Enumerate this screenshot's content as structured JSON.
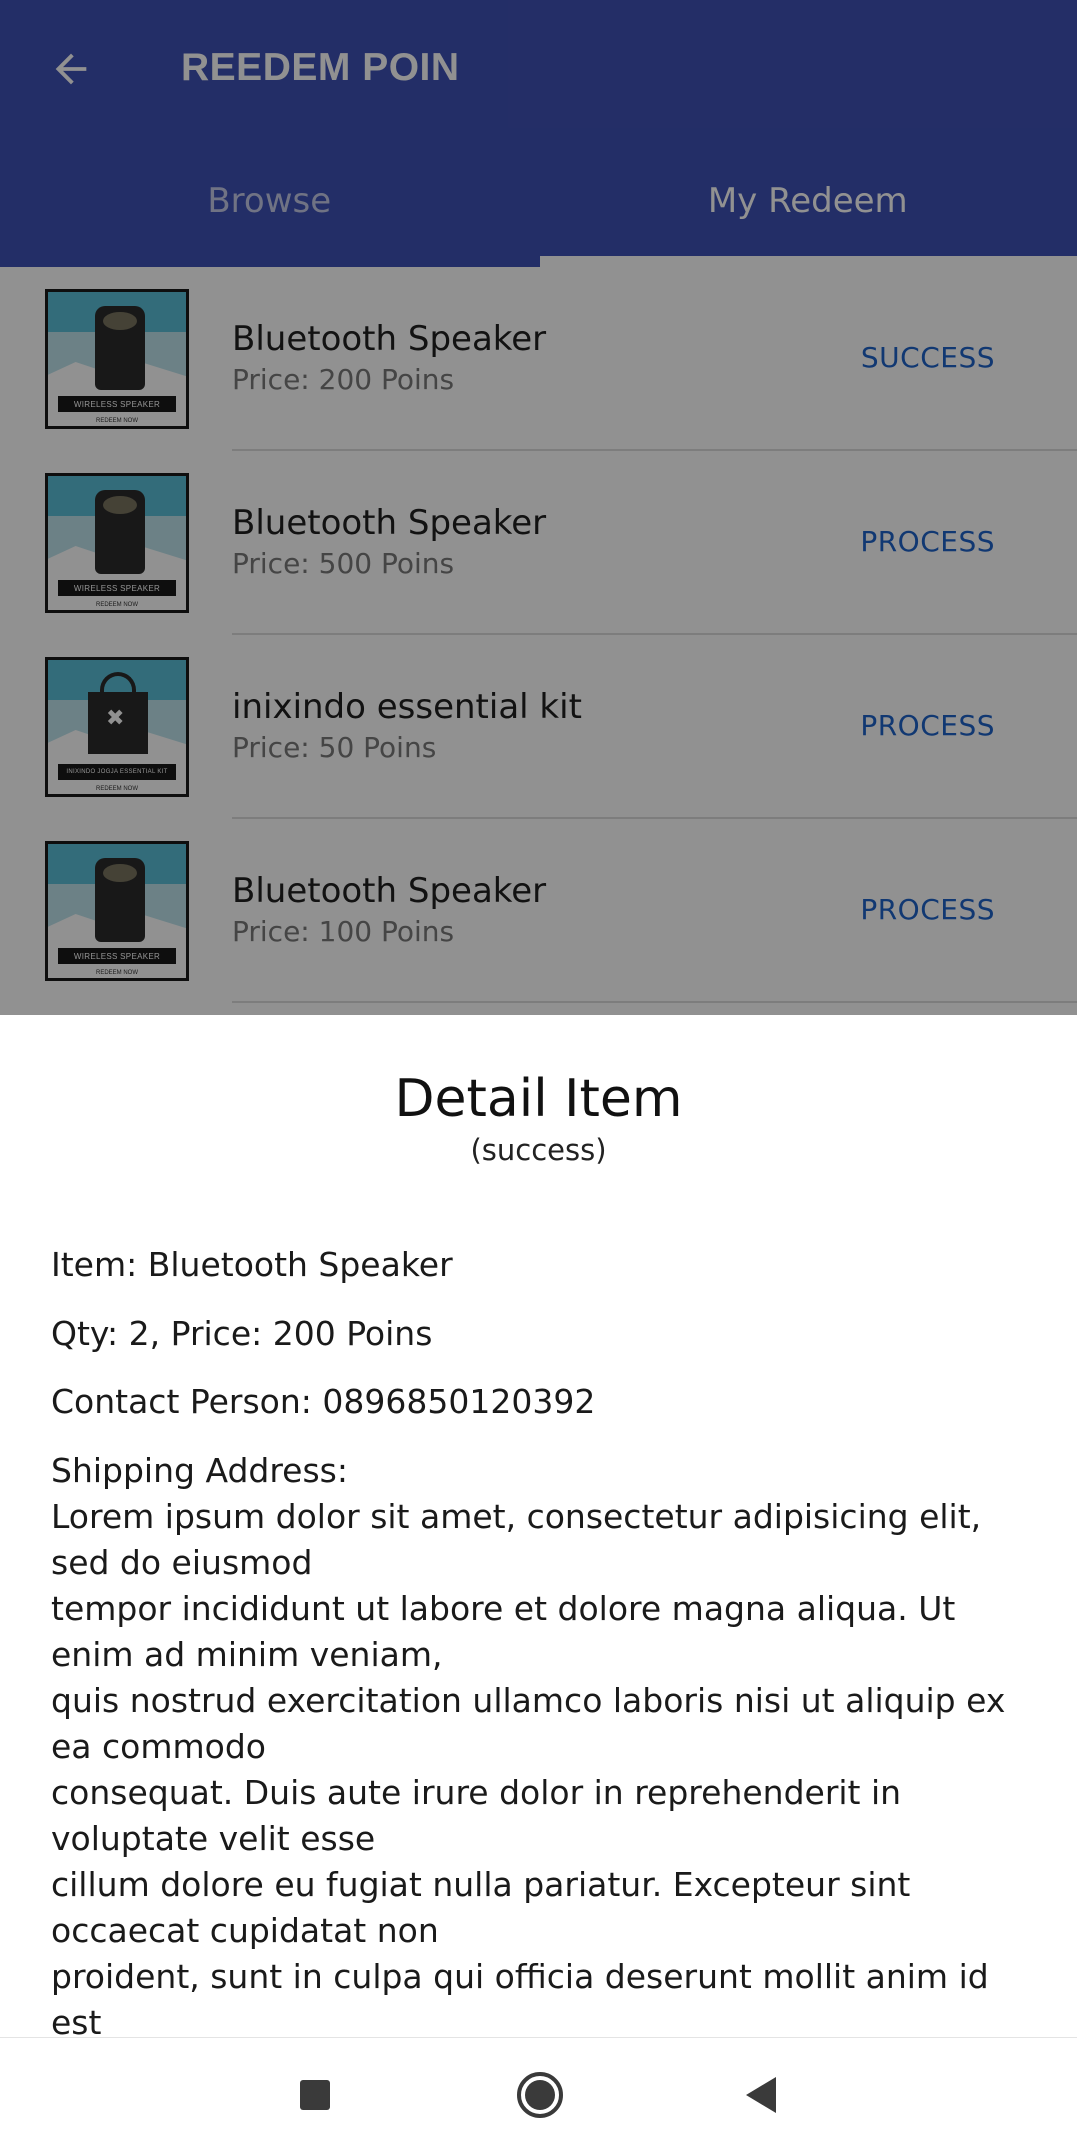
{
  "appbar": {
    "title": "REEDEM POIN",
    "back_icon": "arrow-back-icon"
  },
  "tabs": [
    {
      "label": "Browse"
    },
    {
      "label": "My Redeem"
    }
  ],
  "items": [
    {
      "name": "Bluetooth Speaker",
      "price": "Price: 200 Poins",
      "status": "SUCCESS",
      "thumb_label": "WIRELESS SPEAKER",
      "thumb_sub": "REDEEM NOW"
    },
    {
      "name": "Bluetooth Speaker",
      "price": "Price: 500 Poins",
      "status": "PROCESS",
      "thumb_label": "WIRELESS SPEAKER",
      "thumb_sub": "REDEEM NOW"
    },
    {
      "name": "inixindo essential kit",
      "price": "Price: 50 Poins",
      "status": "PROCESS",
      "thumb_label": "INIXINDO JOGJA ESSENTIAL KIT",
      "thumb_sub": "REDEEM NOW"
    },
    {
      "name": "Bluetooth Speaker",
      "price": "Price: 100 Poins",
      "status": "PROCESS",
      "thumb_label": "WIRELESS SPEAKER",
      "thumb_sub": "REDEEM NOW"
    }
  ],
  "sheet": {
    "title": "Detail Item",
    "subtitle": "(success)",
    "item": "Item: Bluetooth Speaker",
    "qty_price": "Qty: 2,   Price: 200 Poins",
    "contact": "Contact Person: 0896850120392",
    "address_label": "Shipping Address:",
    "address_lines": [
      "Lorem ipsum dolor sit amet, consectetur adipisicing elit, sed do eiusmod",
      "tempor incididunt ut labore et dolore magna aliqua. Ut enim ad minim veniam,",
      "quis nostrud exercitation ullamco laboris nisi ut aliquip ex ea commodo",
      "consequat. Duis aute irure dolor in reprehenderit in voluptate velit esse",
      "cillum dolore eu fugiat nulla pariatur. Excepteur sint occaecat cupidatat non",
      "proident, sunt in culpa qui officia deserunt mollit anim id est"
    ]
  },
  "navbar": {
    "recents_icon": "recents-square-icon",
    "home_icon": "home-circle-icon",
    "back_icon": "back-triangle-icon"
  },
  "colors": {
    "primary": "#3F51B5",
    "status": "#1e63c8",
    "scrim": "rgba(0,0,0,0.43)"
  }
}
